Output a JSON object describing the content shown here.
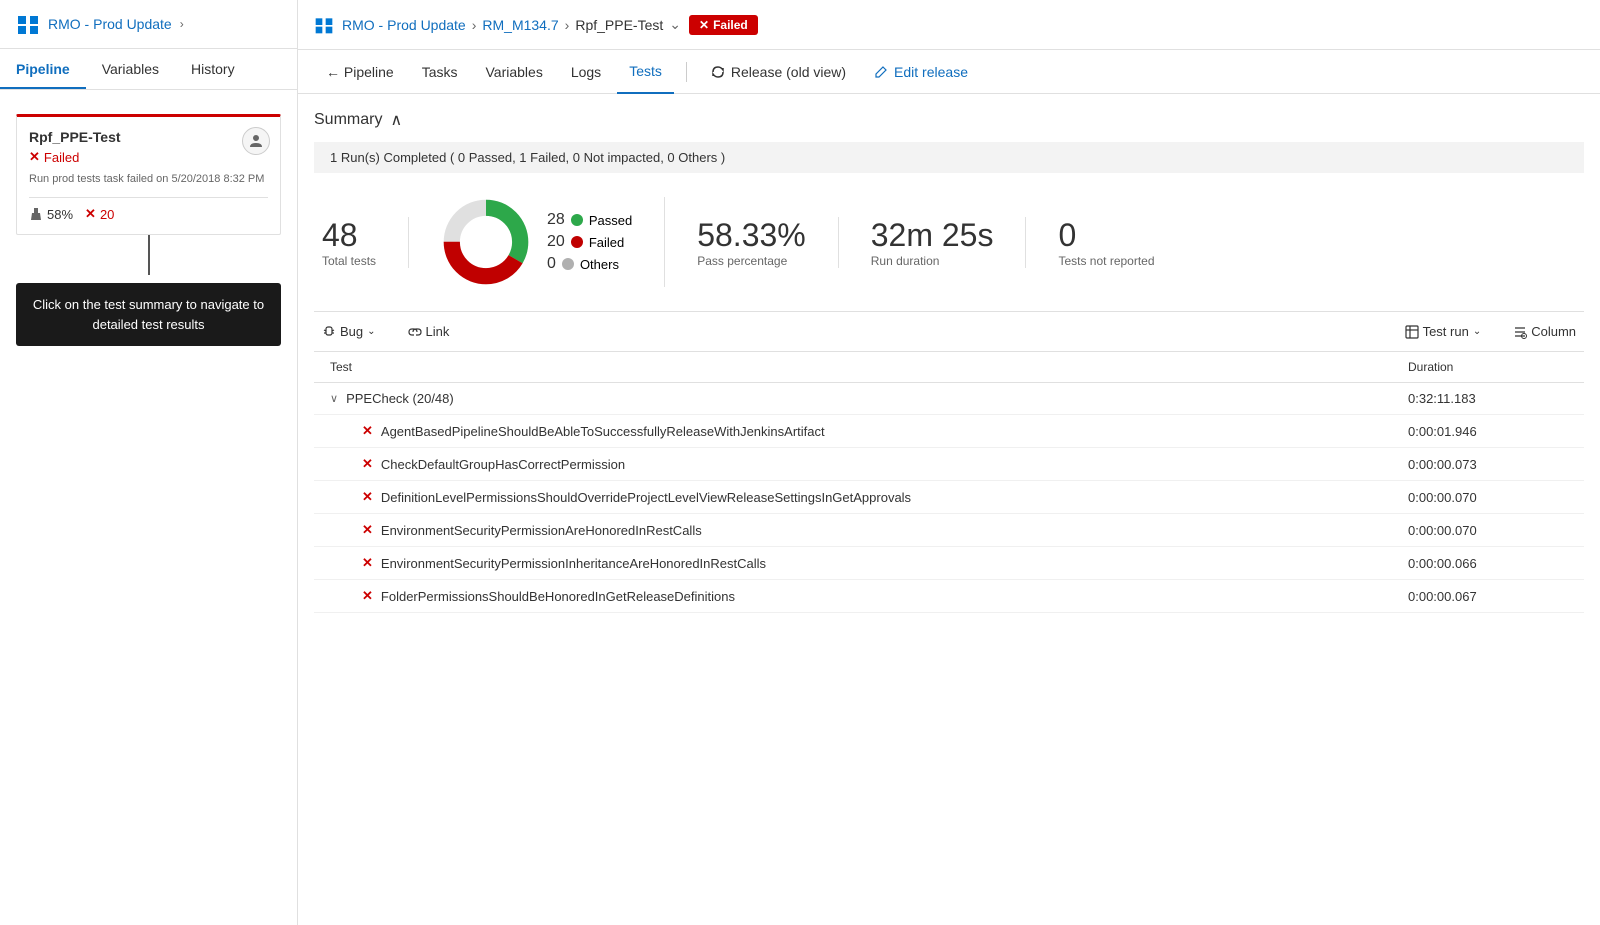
{
  "sidebar": {
    "title": "RMO - Prod Update",
    "chevron": "›",
    "nav": {
      "pipeline": "Pipeline",
      "variables": "Variables",
      "history": "History"
    },
    "stage": {
      "name": "Rpf_PPE-Test",
      "status": "Failed",
      "description": "Run prod tests task failed on 5/20/2018 8:32 PM",
      "pass_pct": "58%",
      "fail_count": "20"
    },
    "tooltip": "Click on the test summary to navigate to detailed test results"
  },
  "header": {
    "breadcrumb": {
      "project": "RMO - Prod Update",
      "release": "RM_M134.7",
      "stage": "Rpf_PPE-Test"
    },
    "status_badge": "Failed",
    "status_x": "✕"
  },
  "nav": {
    "pipeline": "← Pipeline",
    "tasks": "Tasks",
    "variables": "Variables",
    "logs": "Logs",
    "tests": "Tests",
    "release_old": "Release (old view)",
    "edit_release": "Edit release"
  },
  "summary": {
    "title": "Summary",
    "chevron": "∧",
    "run_info": "1 Run(s) Completed ( 0 Passed, 1 Failed, 0 Not impacted, 0 Others )",
    "total_tests": "48",
    "total_tests_label": "Total tests",
    "passed_count": "28",
    "failed_count": "20",
    "others_count": "0",
    "passed_label": "Passed",
    "failed_label": "Failed",
    "others_label": "Others",
    "pass_pct": "58.33%",
    "pass_pct_label": "Pass percentage",
    "run_duration": "32m 25s",
    "run_duration_label": "Run duration",
    "not_reported": "0",
    "not_reported_label": "Tests not reported",
    "colors": {
      "passed": "#2da84a",
      "failed": "#c00000",
      "others": "#b0b0b0"
    }
  },
  "toolbar": {
    "bug_label": "Bug",
    "link_label": "Link",
    "test_run_label": "Test run",
    "column_label": "Column"
  },
  "test_table": {
    "col_test": "Test",
    "col_duration": "Duration",
    "group": {
      "name": "PPECheck (20/48)",
      "duration": "0:32:11.183"
    },
    "rows": [
      {
        "name": "AgentBasedPipelineShouldBeAbleToSuccessfullyReleaseWithJenkinsArtifact",
        "duration": "0:00:01.946"
      },
      {
        "name": "CheckDefaultGroupHasCorrectPermission",
        "duration": "0:00:00.073"
      },
      {
        "name": "DefinitionLevelPermissionsShouldOverrideProjectLevelViewReleaseSettingsInGetApprovals",
        "duration": "0:00:00.070"
      },
      {
        "name": "EnvironmentSecurityPermissionAreHonoredInRestCalls",
        "duration": "0:00:00.070"
      },
      {
        "name": "EnvironmentSecurityPermissionInheritanceAreHonoredInRestCalls",
        "duration": "0:00:00.066"
      },
      {
        "name": "FolderPermissionsShouldBeHonoredInGetReleaseDefinitions",
        "duration": "0:00:00.067"
      }
    ]
  }
}
